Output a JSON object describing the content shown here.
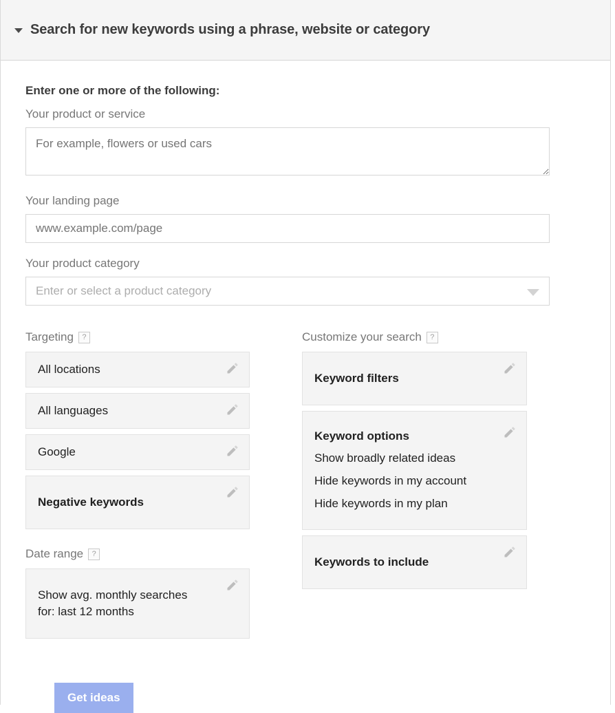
{
  "header": {
    "title": "Search for new keywords using a phrase, website or category",
    "collapse_icon": "triangle-down-icon"
  },
  "form": {
    "heading": "Enter one or more of the following:",
    "product_or_service": {
      "label": "Your product or service",
      "placeholder": "For example, flowers or used cars",
      "value": ""
    },
    "landing_page": {
      "label": "Your landing page",
      "placeholder": "www.example.com/page",
      "value": ""
    },
    "product_category": {
      "label": "Your product category",
      "placeholder": "Enter or select a product category",
      "value": "",
      "dropdown_icon": "chevron-down-icon"
    }
  },
  "targeting": {
    "label": "Targeting",
    "help_icon": "help-question-icon",
    "help_label": "?",
    "items": [
      {
        "title": "All locations",
        "bold": false,
        "edit_icon": "pencil-icon"
      },
      {
        "title": "All languages",
        "bold": false,
        "edit_icon": "pencil-icon"
      },
      {
        "title": "Google",
        "bold": false,
        "edit_icon": "pencil-icon"
      },
      {
        "title": "Negative keywords",
        "bold": true,
        "edit_icon": "pencil-icon"
      }
    ]
  },
  "date_range": {
    "label": "Date range",
    "help_icon": "help-question-icon",
    "help_label": "?",
    "item": {
      "line1": "Show avg. monthly searches",
      "line2": "for: last 12 months",
      "edit_icon": "pencil-icon"
    }
  },
  "customize": {
    "label": "Customize your search",
    "help_icon": "help-question-icon",
    "help_label": "?",
    "keyword_filters": {
      "title": "Keyword filters",
      "edit_icon": "pencil-icon"
    },
    "keyword_options": {
      "title": "Keyword options",
      "options": [
        "Show broadly related ideas",
        "Hide keywords in my account",
        "Hide keywords in my plan"
      ],
      "edit_icon": "pencil-icon"
    },
    "keywords_to_include": {
      "title": "Keywords to include",
      "edit_icon": "pencil-icon"
    }
  },
  "footer": {
    "get_ideas_label": "Get ideas"
  },
  "colors": {
    "header_bg": "#f5f5f5",
    "card_bg": "#f4f4f4",
    "primary_button": "#9aafee",
    "label_text": "#777777",
    "body_text": "#212121"
  }
}
